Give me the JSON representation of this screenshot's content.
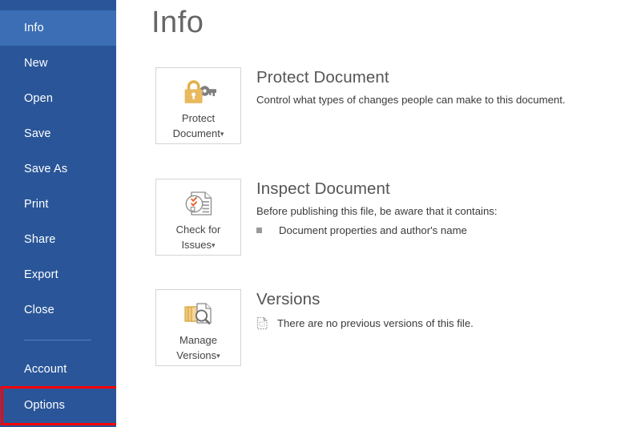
{
  "app": {
    "screen": "backstage-info",
    "title": "Info",
    "colors": {
      "sidebar_bg": "#2A5699",
      "sidebar_selected": "#3B6EB4",
      "sidebar_separator": "#5481BE",
      "highlight_box": "#FF0000",
      "title_text": "#666666",
      "icon_gold": "#E3B04B",
      "icon_gray": "#808080",
      "icon_orange": "#E8612C"
    }
  },
  "sidebar": {
    "items": [
      {
        "label": "Info",
        "selected": true,
        "icon": "info-item"
      },
      {
        "label": "New",
        "selected": false,
        "icon": "new-item"
      },
      {
        "label": "Open",
        "selected": false,
        "icon": "open-item"
      },
      {
        "label": "Save",
        "selected": false,
        "icon": "save-item"
      },
      {
        "label": "Save As",
        "selected": false,
        "icon": "save-as-item"
      },
      {
        "label": "Print",
        "selected": false,
        "icon": "print-item"
      },
      {
        "label": "Share",
        "selected": false,
        "icon": "share-item"
      },
      {
        "label": "Export",
        "selected": false,
        "icon": "export-item"
      },
      {
        "label": "Close",
        "selected": false,
        "icon": "close-item"
      },
      {
        "label": "Account",
        "selected": false,
        "icon": "account-item"
      },
      {
        "label": "Options",
        "selected": false,
        "icon": "options-item"
      }
    ],
    "separator_after_index": 8,
    "highlighted_item": "Options"
  },
  "main": {
    "heading": "Info",
    "sections": [
      {
        "id": "protect",
        "title": "Protect Document",
        "description": "Control what types of changes people can make to this document.",
        "button": {
          "line1": "Protect",
          "line2": "Document",
          "caret": "▾",
          "icon": "lock-and-key-icon"
        }
      },
      {
        "id": "inspect",
        "title": "Inspect Document",
        "description": "Before publishing this file, be aware that it contains:",
        "list": [
          "Document properties and author's name"
        ],
        "button": {
          "line1": "Check for",
          "line2": "Issues",
          "caret": "▾",
          "icon": "document-checkmarks-icon"
        }
      },
      {
        "id": "versions",
        "title": "Versions",
        "note": "There are no previous versions of this file.",
        "note_icon": "dashed-document-icon",
        "button": {
          "line1": "Manage",
          "line2": "Versions",
          "caret": "▾",
          "icon": "stacked-documents-magnifier-icon"
        }
      }
    ]
  }
}
